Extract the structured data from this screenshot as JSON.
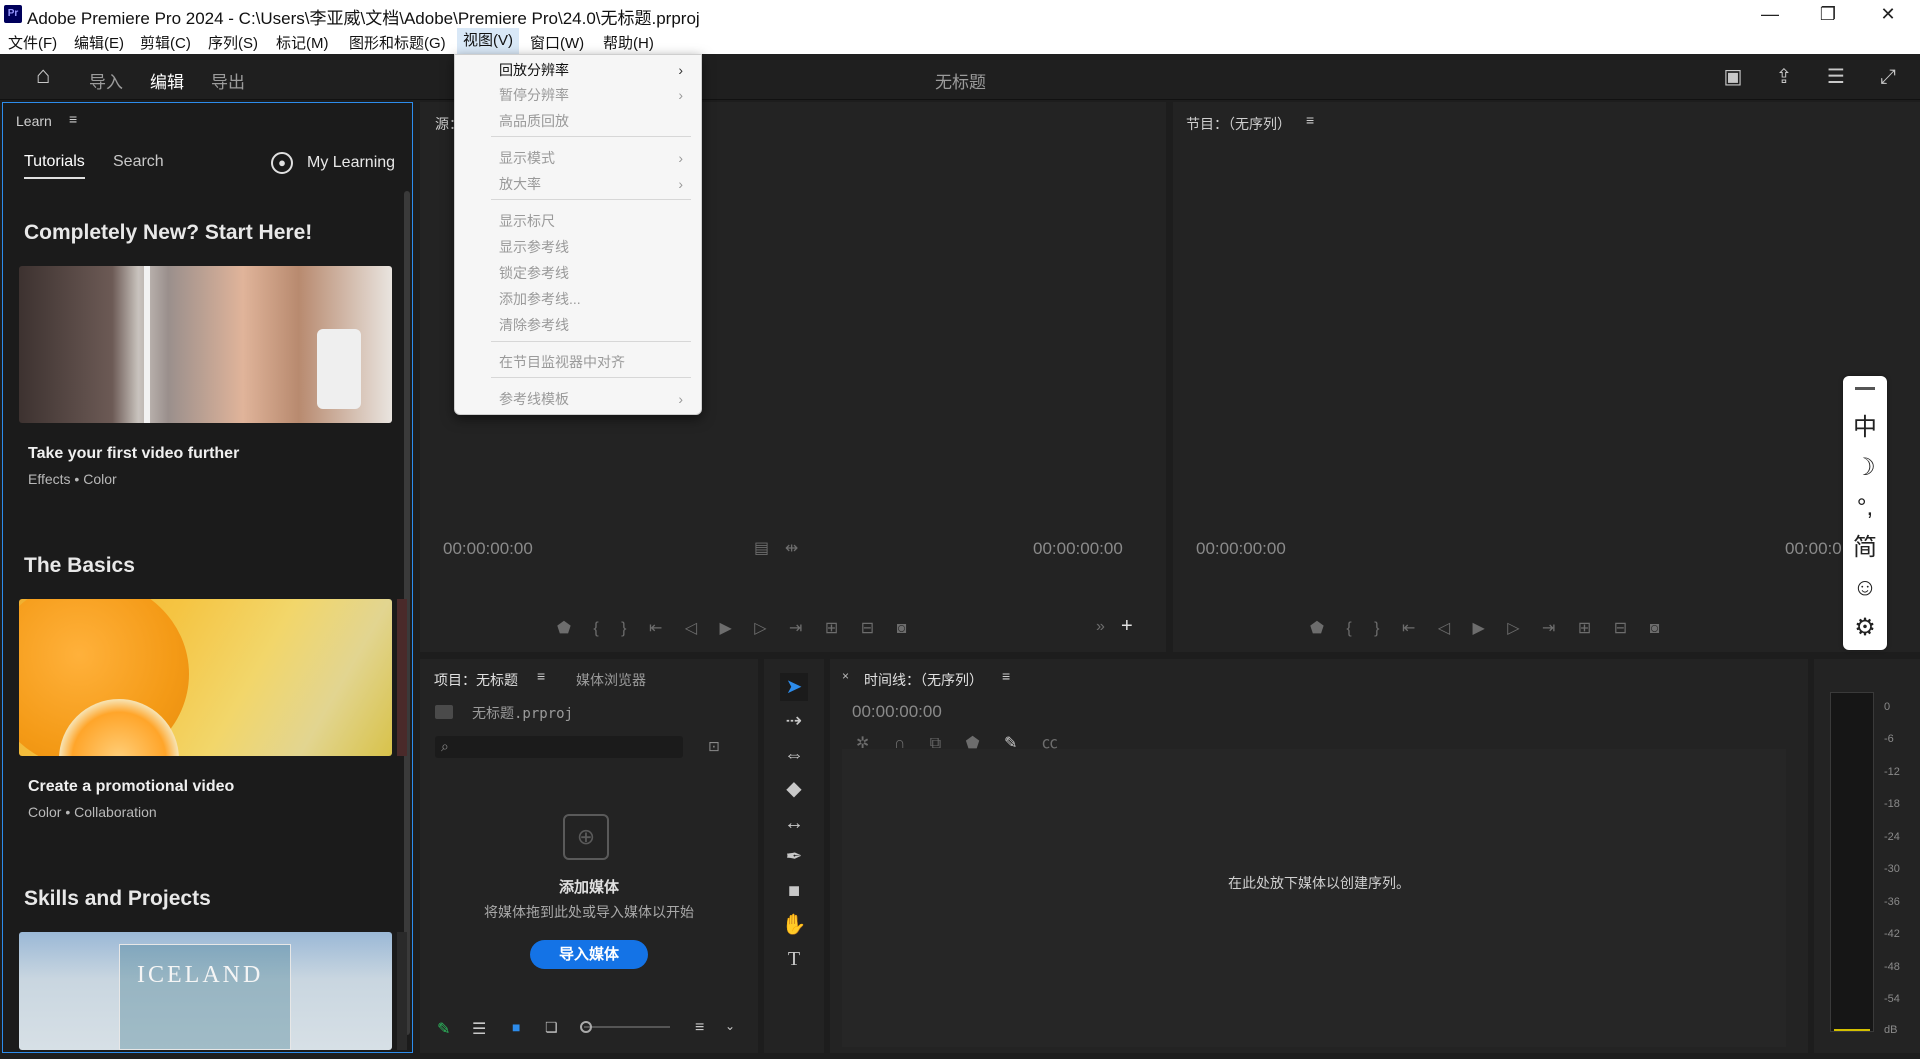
{
  "window": {
    "title": "Adobe Premiere Pro 2024 - C:\\Users\\李亚威\\文档\\Adobe\\Premiere Pro\\24.0\\无标题.prproj",
    "app_icon": "Pr"
  },
  "menubar": [
    "文件(F)",
    "编辑(E)",
    "剪辑(C)",
    "序列(S)",
    "标记(M)",
    "图形和标题(G)",
    "视图(V)",
    "窗口(W)",
    "帮助(H)"
  ],
  "workspace": {
    "tabs": [
      "导入",
      "编辑",
      "导出"
    ],
    "active_tab": "编辑",
    "project_title": "无标题"
  },
  "view_menu": {
    "items": [
      {
        "label": "回放分辨率",
        "enabled": true,
        "submenu": true
      },
      {
        "label": "暂停分辨率",
        "enabled": false,
        "submenu": true
      },
      {
        "label": "高品质回放",
        "enabled": false,
        "submenu": false
      },
      {
        "label": "显示模式",
        "enabled": false,
        "submenu": true
      },
      {
        "label": "放大率",
        "enabled": false,
        "submenu": true
      },
      {
        "label": "显示标尺",
        "enabled": false,
        "submenu": false
      },
      {
        "label": "显示参考线",
        "enabled": false,
        "submenu": false
      },
      {
        "label": "锁定参考线",
        "enabled": false,
        "submenu": false
      },
      {
        "label": "添加参考线...",
        "enabled": false,
        "submenu": false
      },
      {
        "label": "清除参考线",
        "enabled": false,
        "submenu": false
      },
      {
        "label": "在节目监视器中对齐",
        "enabled": false,
        "submenu": false
      },
      {
        "label": "参考线模板",
        "enabled": false,
        "submenu": true
      }
    ]
  },
  "learn": {
    "panel_title": "Learn",
    "tabs": [
      "Tutorials",
      "Search"
    ],
    "my_learning": "My Learning",
    "sections": [
      {
        "heading": "Completely New? Start Here!",
        "card_title": "Take your first video further",
        "tags": [
          "Effects",
          "Color"
        ]
      },
      {
        "heading": "The Basics",
        "card_title": "Create a promotional video",
        "tags": [
          "Color",
          "Collaboration"
        ]
      },
      {
        "heading": "Skills and Projects",
        "card_overlay_text": "ICELAND"
      }
    ]
  },
  "source_monitor": {
    "title": "源：",
    "tc_left": "00:00:00:00",
    "tc_right": "00:00:00:00"
  },
  "program_monitor": {
    "title": "节目：（无序列）",
    "tc_left": "00:00:00:00",
    "tc_right": "00:00:0"
  },
  "project_panel": {
    "title": "项目：无标题",
    "tab_media": "媒体浏览器",
    "file": "无标题.prproj",
    "add_media_title": "添加媒体",
    "add_media_sub": "将媒体拖到此处或导入媒体以开始",
    "import_button": "导入媒体"
  },
  "timeline": {
    "title": "时间线：（无序列）",
    "timecode": "00:00:00:00",
    "drop_hint": "在此处放下媒体以创建序列。"
  },
  "audio_meter": {
    "labels": [
      "0",
      "-6",
      "-12",
      "-18",
      "-24",
      "-30",
      "-36",
      "-42",
      "-48",
      "-54",
      "dB"
    ]
  },
  "ime_toolbar": {
    "items": [
      "中",
      "☽",
      "°,",
      "简",
      "☺",
      "⚙"
    ]
  },
  "colors": {
    "accent": "#2d8ceb",
    "import_btn": "#1473e6",
    "menu_bg": "#f6f6f6"
  }
}
